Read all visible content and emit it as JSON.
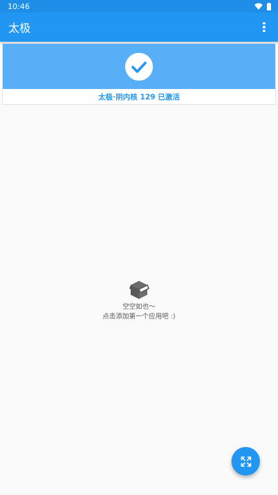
{
  "status_bar": {
    "time": "10:46",
    "icons": [
      "wifi-icon",
      "battery-icon"
    ]
  },
  "app_bar": {
    "title": "太极",
    "menu_icon": "overflow-menu-icon"
  },
  "status_card": {
    "icon": "check-circle-icon",
    "text": "太极·阴内核 129 已激活"
  },
  "empty_state": {
    "icon": "box-icon",
    "line1": "空空如也～",
    "line2": "点击添加第一个应用吧 :)"
  },
  "fab": {
    "icon": "expand-icon"
  },
  "colors": {
    "primary": "#2196f3",
    "status_bar": "#1f8ee9",
    "card_header": "#57b0f7",
    "background": "#fafafa"
  }
}
